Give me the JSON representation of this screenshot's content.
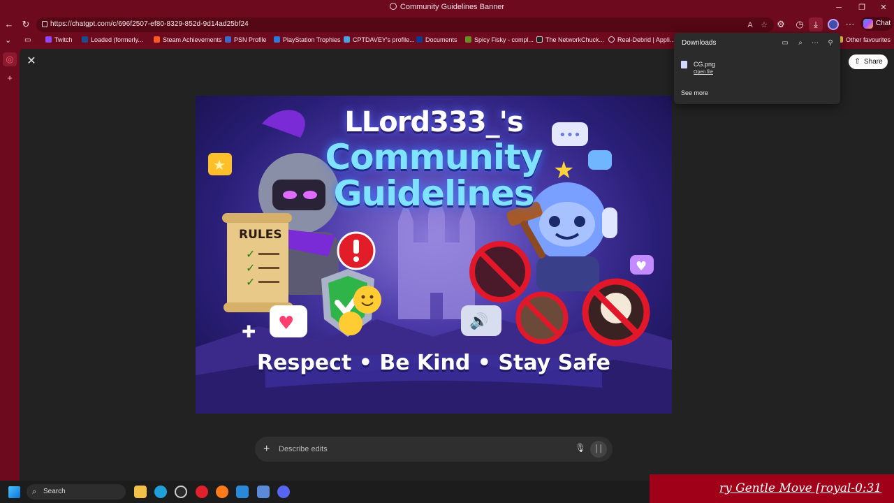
{
  "window": {
    "title": "Community Guidelines Banner"
  },
  "address": {
    "url": "https://chatgpt.com/c/696f2507-ef80-8329-852d-9d14ad25bf24"
  },
  "toolbar": {
    "chat_label": "Chat"
  },
  "bookmarks": [
    {
      "label": "Twitch",
      "color": "#9146ff"
    },
    {
      "label": "Loaded (formerly...",
      "color": "#1a4d8f"
    },
    {
      "label": "Steam Achievements",
      "color": "#ff5a1f"
    },
    {
      "label": "PSN Profile",
      "color": "#3c6ac8"
    },
    {
      "label": "PlayStation Trophies",
      "color": "#2c7bd6"
    },
    {
      "label": "CPTDAVEY's profile...",
      "color": "#4aa3df"
    },
    {
      "label": "Documents",
      "color": "#0b3b8f"
    },
    {
      "label": "Spicy Fisky - compl...",
      "color": "#6b8e23"
    },
    {
      "label": "The NetworkChuck...",
      "color": "#222222"
    },
    {
      "label": "Real-Debrid | Appli...",
      "color": "#e0e0e0"
    },
    {
      "label": "Other favourites",
      "color": "#f0c040"
    }
  ],
  "page": {
    "share_label": "Share"
  },
  "banner": {
    "title_line1": "LLord333_'s",
    "title_line2a": "Community",
    "title_line2b": "Guidelines",
    "rules_label": "RULES",
    "tagline": "Respect • Be Kind • Stay Safe"
  },
  "edit": {
    "placeholder": "Describe edits"
  },
  "downloads": {
    "title": "Downloads",
    "file_name": "CG.png",
    "open_file": "Open file",
    "see_more": "See more"
  },
  "taskbar": {
    "search_label": "Search"
  },
  "overlay": {
    "text": "ry Gentle Move [royal-0:31"
  }
}
